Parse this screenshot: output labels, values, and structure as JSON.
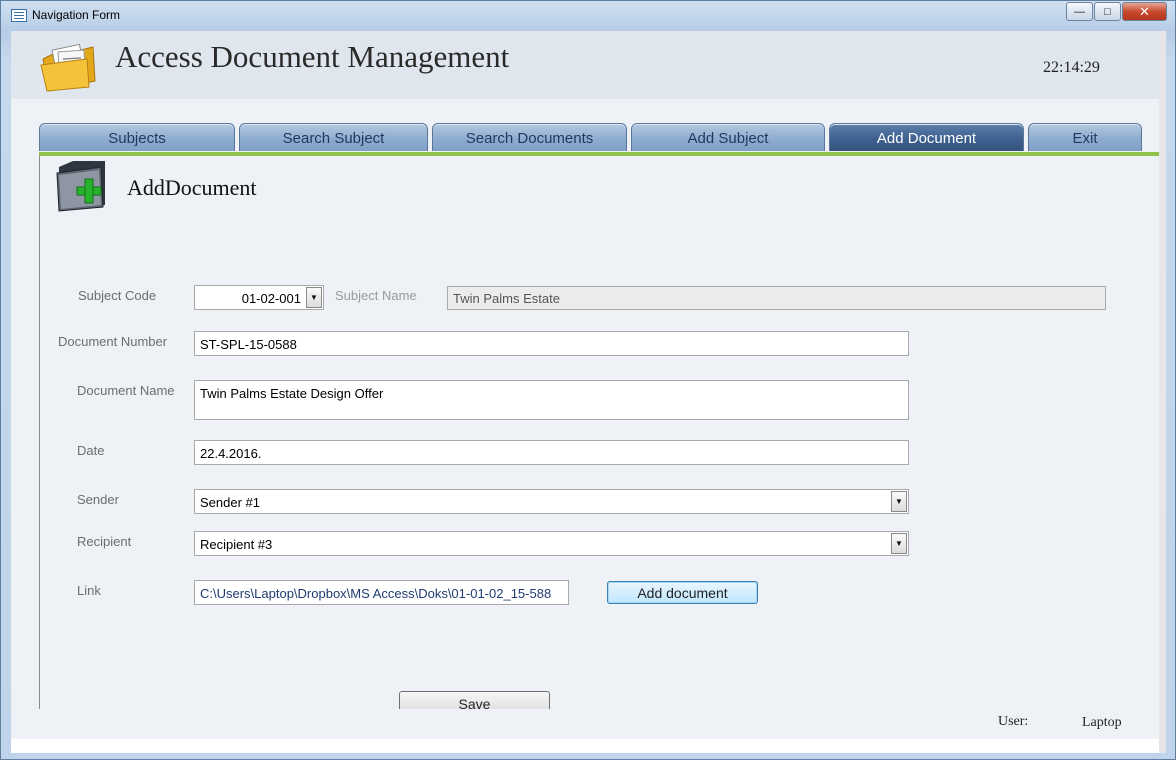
{
  "window": {
    "title": "Navigation Form"
  },
  "header": {
    "app_title": "Access Document Management",
    "clock": "22:14:29"
  },
  "tabs": [
    {
      "label": "Subjects",
      "active": false
    },
    {
      "label": "Search Subject",
      "active": false
    },
    {
      "label": "Search Documents",
      "active": false
    },
    {
      "label": "Add Subject",
      "active": false
    },
    {
      "label": "Add Document",
      "active": true
    },
    {
      "label": "Exit",
      "active": false
    }
  ],
  "form": {
    "title": "AddDocument",
    "subject_code": {
      "label": "Subject Code",
      "value": "01-02-001"
    },
    "subject_name": {
      "label": "Subject Name",
      "value": "Twin Palms Estate"
    },
    "document_number": {
      "label": "Document Number",
      "value": "ST-SPL-15-0588"
    },
    "document_name": {
      "label": "Document Name",
      "value": "Twin Palms Estate Design Offer"
    },
    "date": {
      "label": "Date",
      "value": "22.4.2016."
    },
    "sender": {
      "label": "Sender",
      "value": "Sender #1"
    },
    "recipient": {
      "label": "Recipient",
      "value": "Recipient #3"
    },
    "link": {
      "label": "Link",
      "value": "C:\\Users\\Laptop\\Dropbox\\MS Access\\Doks\\01-01-02_15-588"
    },
    "add_document_button": "Add document",
    "save_button": "Save"
  },
  "status": {
    "user_label": "User:",
    "user_value": "Laptop"
  },
  "colors": {
    "tab_active": "#3f6190",
    "tab_inactive": "#8eacd0",
    "accent_line": "#8ec24b"
  }
}
